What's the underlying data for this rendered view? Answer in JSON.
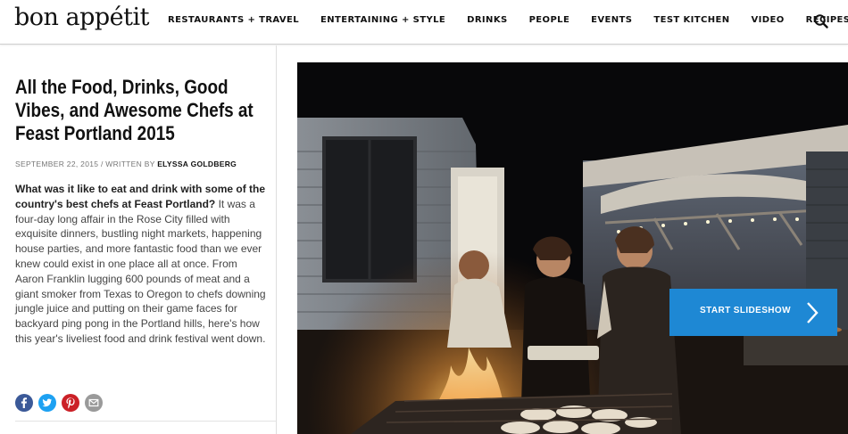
{
  "header": {
    "logo": "bon appétit",
    "nav": [
      "RESTAURANTS + TRAVEL",
      "ENTERTAINING + STYLE",
      "DRINKS",
      "PEOPLE",
      "EVENTS",
      "TEST KITCHEN",
      "VIDEO",
      "RECIPES"
    ],
    "search_icon": "search-icon"
  },
  "article": {
    "title": "All the Food, Drinks, Good Vibes, and Awesome Chefs at Feast Portland 2015",
    "date": "SEPTEMBER 22, 2015",
    "byline_prefix": " / WRITTEN BY ",
    "author": "ELYSSA GOLDBERG",
    "lead": "What was it like to eat and drink with some of the country's best chefs at Feast Portland?",
    "body": " It was a four-day long affair in the Rose City filled with exquisite dinners, bustling night markets, happening house parties, and more fantastic food than we ever knew could exist in one place all at once. From Aaron Franklin lugging 600 pounds of meat and a giant smoker from Texas to Oregon to chefs downing jungle juice and putting on their game faces for backyard ping pong in the Portland hills, here's how this year's liveliest food and drink festival went down."
  },
  "share": [
    {
      "icon": "facebook-icon",
      "color": "#3b5998"
    },
    {
      "icon": "twitter-icon",
      "color": "#1da1f2"
    },
    {
      "icon": "pinterest-icon",
      "color": "#cb2027"
    },
    {
      "icon": "email-icon",
      "color": "#9a9a9a"
    }
  ],
  "hero": {
    "cta_label": "START SLIDESHOW",
    "cta_color": "#1e88d4",
    "cta_icon": "chevron-right-icon"
  }
}
